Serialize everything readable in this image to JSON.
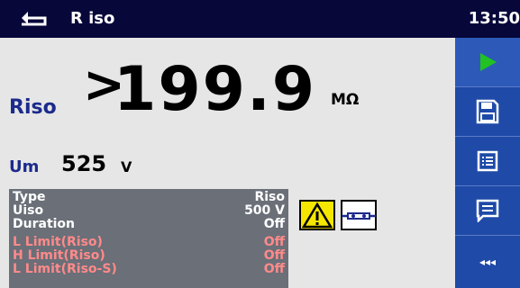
{
  "header": {
    "title": "R iso",
    "time": "13:50"
  },
  "result": {
    "label": "Riso",
    "prefix": ">",
    "value": "199.9",
    "unit": "MΩ"
  },
  "sub_result": {
    "label": "Um",
    "value": "525",
    "unit": "V"
  },
  "params": [
    {
      "key": "Type",
      "value": "Riso",
      "style": "normal"
    },
    {
      "key": "Uiso",
      "value": "500 V",
      "style": "normal"
    },
    {
      "key": "Duration",
      "value": "Off",
      "style": "normal"
    },
    {
      "key": "L Limit(Riso)",
      "value": "Off",
      "style": "red"
    },
    {
      "key": "H Limit(Riso)",
      "value": "Off",
      "style": "red"
    },
    {
      "key": "L Limit(Riso-S)",
      "value": "Off",
      "style": "red"
    }
  ],
  "sidebar": {
    "buttons": [
      {
        "name": "start-test",
        "icon": "play-icon"
      },
      {
        "name": "save",
        "icon": "floppy-disk-icon"
      },
      {
        "name": "memory-list",
        "icon": "list-icon"
      },
      {
        "name": "comment",
        "icon": "comment-icon"
      },
      {
        "name": "more",
        "label": "◂◂◂"
      }
    ]
  },
  "status_icons": [
    {
      "name": "warning",
      "icon": "warning-icon"
    },
    {
      "name": "connection",
      "icon": "connection-icon"
    }
  ],
  "colors": {
    "topbar": "#07073a",
    "sidebar": "#1f4aa8",
    "play": "#22c222",
    "label_blue": "#1b2a8c",
    "panel_grey": "#6a6f78",
    "warning_yellow": "#f5e600"
  }
}
